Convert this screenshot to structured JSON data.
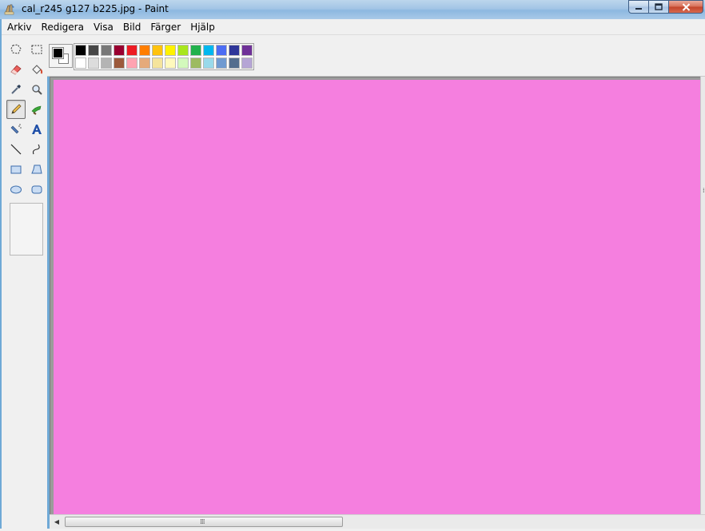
{
  "window": {
    "title": "cal_r245 g127 b225.jpg - Paint",
    "app_icon": "paint-icon",
    "controls": [
      "minimize-icon",
      "maximize-icon",
      "close-icon"
    ]
  },
  "menu": {
    "items": [
      "Arkiv",
      "Redigera",
      "Visa",
      "Bild",
      "Färger",
      "Hjälp"
    ]
  },
  "colors": {
    "foreground": "#000000",
    "background": "#ffffff",
    "canvas_fill": "#f57fdf",
    "palette_row1": [
      "#000000",
      "#464646",
      "#787878",
      "#990030",
      "#ed1c24",
      "#ff7e00",
      "#ffc20e",
      "#fff200",
      "#a8e61d",
      "#22b14c",
      "#00b7ef",
      "#4d6df3",
      "#2f3699",
      "#6f3198"
    ],
    "palette_row2": [
      "#ffffff",
      "#dcdcdc",
      "#b4b4b4",
      "#9c5a3c",
      "#ffa3b1",
      "#e5aa7a",
      "#f5e49c",
      "#fff9bd",
      "#d3f9bc",
      "#9dbb61",
      "#99d9ea",
      "#709ad1",
      "#546d8e",
      "#b5a5d5"
    ]
  },
  "toolbox": {
    "tools": [
      {
        "name": "free-form-select",
        "icon": "lasso-icon"
      },
      {
        "name": "select",
        "icon": "rect-select-icon"
      },
      {
        "name": "eraser",
        "icon": "eraser-icon"
      },
      {
        "name": "fill",
        "icon": "paint-bucket-icon"
      },
      {
        "name": "pick-color",
        "icon": "eyedropper-icon"
      },
      {
        "name": "magnifier",
        "icon": "magnifier-icon"
      },
      {
        "name": "pencil",
        "icon": "pencil-icon",
        "selected": true
      },
      {
        "name": "brush",
        "icon": "brush-icon"
      },
      {
        "name": "airbrush",
        "icon": "airbrush-icon"
      },
      {
        "name": "text",
        "icon": "text-icon"
      },
      {
        "name": "line",
        "icon": "line-icon"
      },
      {
        "name": "curve",
        "icon": "curve-icon"
      },
      {
        "name": "rectangle",
        "icon": "rectangle-icon"
      },
      {
        "name": "polygon",
        "icon": "polygon-icon"
      },
      {
        "name": "ellipse",
        "icon": "ellipse-icon"
      },
      {
        "name": "rounded-rectangle",
        "icon": "rounded-rectangle-icon"
      }
    ]
  }
}
